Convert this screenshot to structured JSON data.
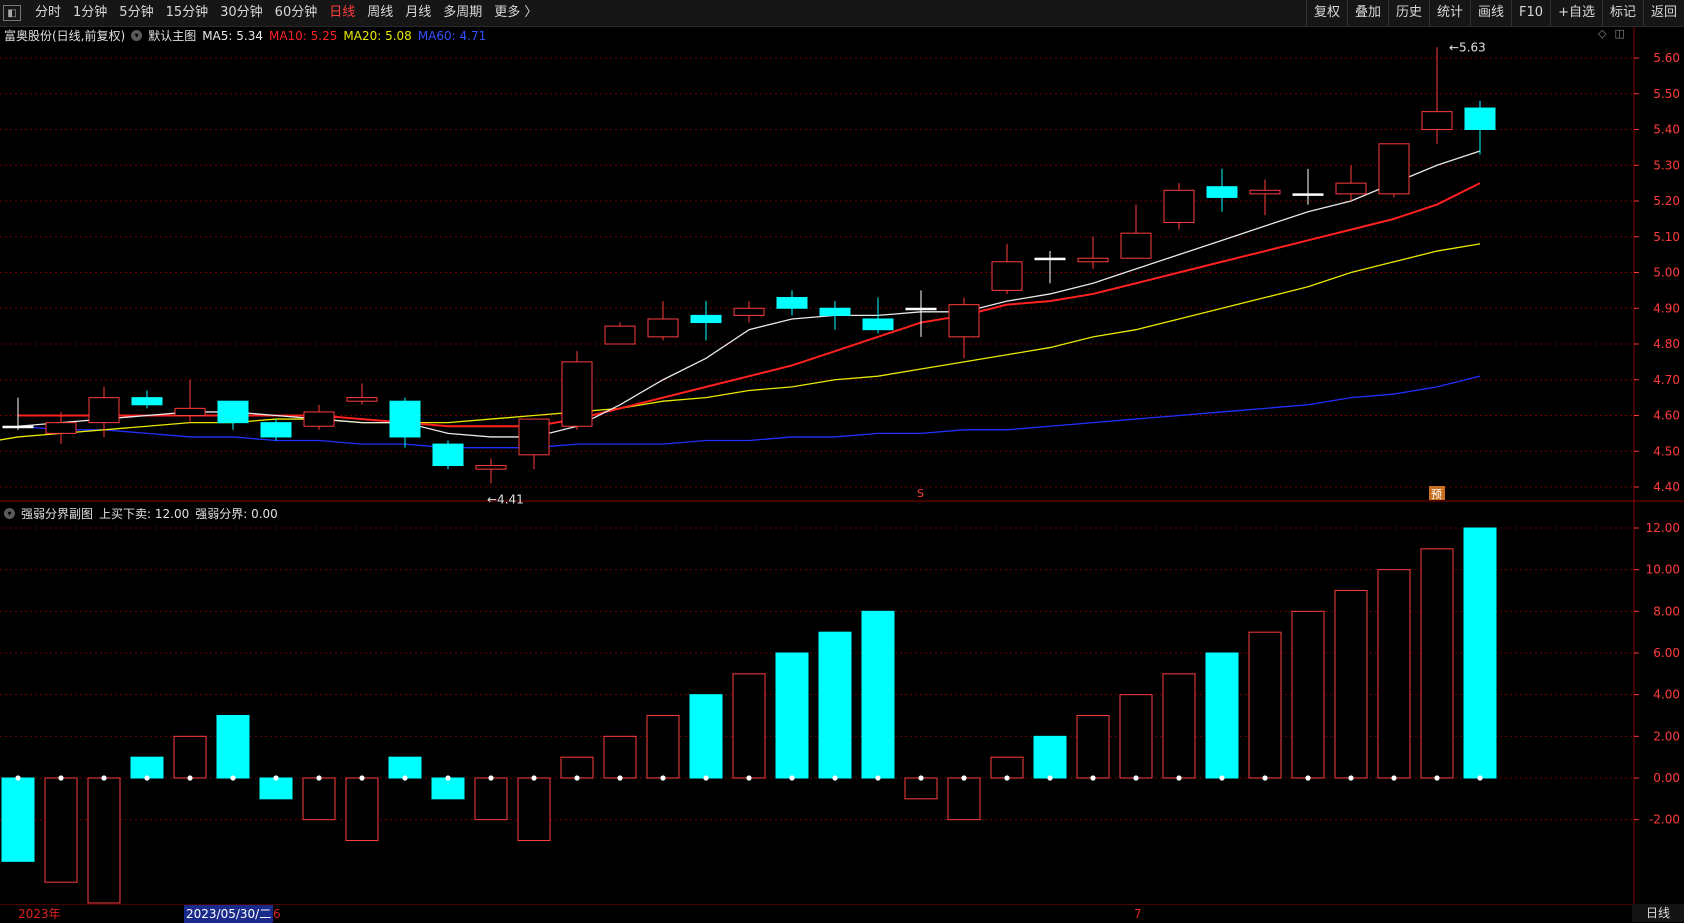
{
  "toolbar": {
    "periods": [
      "分时",
      "1分钟",
      "5分钟",
      "15分钟",
      "30分钟",
      "60分钟",
      "日线",
      "周线",
      "月线",
      "多周期",
      "更多 〉"
    ],
    "active_period": "日线",
    "right_buttons": [
      "复权",
      "叠加",
      "历史",
      "统计",
      "画线",
      "F10",
      "+自选",
      "标记",
      "返回"
    ]
  },
  "main_header": {
    "stock": "富奥股份(日线,前复权)",
    "template": "默认主图",
    "ma5": "MA5: 5.34",
    "ma10": "MA10: 5.25",
    "ma20": "MA20: 5.08",
    "ma60": "MA60: 4.71"
  },
  "sub_header": {
    "title": "强弱分界副图",
    "buy_sell": "上买下卖: 12.00",
    "boundary": "强弱分界: 0.00"
  },
  "top_icons": [
    "diamond-icon",
    "panel-icon"
  ],
  "annotations": {
    "high": "5.63",
    "low": "4.41",
    "marker_s": "S",
    "marker_yu": "预"
  },
  "bottom": {
    "year": "2023年",
    "cursor_date": "2023/05/30/二",
    "month6": "6",
    "month7": "7",
    "period": "日线"
  },
  "colors": {
    "up": "#ff3c3c",
    "down": "#00ffff",
    "flat": "#ffffff",
    "ma5": "#e8e8e8",
    "ma10": "#ff2020",
    "ma20": "#e8e800",
    "ma60": "#2030ff",
    "grid": "#6a0000",
    "axis_text": "#ff3c3c"
  },
  "chart_data": [
    {
      "type": "candlestick",
      "title": "富奥股份(日线,前复权)",
      "y_ticks": [
        "5.60",
        "5.50",
        "5.40",
        "5.30",
        "5.20",
        "5.10",
        "5.00",
        "4.90",
        "4.80",
        "4.70",
        "4.60",
        "4.50",
        "4.40"
      ],
      "ylim": [
        4.39,
        5.65
      ],
      "candles": [
        {
          "o": 4.57,
          "h": 4.65,
          "l": 4.56,
          "c": 4.57
        },
        {
          "o": 4.55,
          "h": 4.61,
          "l": 4.52,
          "c": 4.58
        },
        {
          "o": 4.58,
          "h": 4.68,
          "l": 4.54,
          "c": 4.65
        },
        {
          "o": 4.65,
          "h": 4.67,
          "l": 4.62,
          "c": 4.63
        },
        {
          "o": 4.6,
          "h": 4.7,
          "l": 4.58,
          "c": 4.62
        },
        {
          "o": 4.64,
          "h": 4.64,
          "l": 4.56,
          "c": 4.58
        },
        {
          "o": 4.58,
          "h": 4.59,
          "l": 4.53,
          "c": 4.54
        },
        {
          "o": 4.57,
          "h": 4.63,
          "l": 4.56,
          "c": 4.61
        },
        {
          "o": 4.64,
          "h": 4.69,
          "l": 4.63,
          "c": 4.65
        },
        {
          "o": 4.64,
          "h": 4.65,
          "l": 4.51,
          "c": 4.54
        },
        {
          "o": 4.52,
          "h": 4.53,
          "l": 4.45,
          "c": 4.46
        },
        {
          "o": 4.45,
          "h": 4.48,
          "l": 4.41,
          "c": 4.46
        },
        {
          "o": 4.49,
          "h": 4.59,
          "l": 4.45,
          "c": 4.59
        },
        {
          "o": 4.57,
          "h": 4.78,
          "l": 4.56,
          "c": 4.75
        },
        {
          "o": 4.8,
          "h": 4.86,
          "l": 4.8,
          "c": 4.85
        },
        {
          "o": 4.82,
          "h": 4.92,
          "l": 4.81,
          "c": 4.87
        },
        {
          "o": 4.88,
          "h": 4.92,
          "l": 4.81,
          "c": 4.86
        },
        {
          "o": 4.88,
          "h": 4.92,
          "l": 4.86,
          "c": 4.9
        },
        {
          "o": 4.93,
          "h": 4.95,
          "l": 4.88,
          "c": 4.9
        },
        {
          "o": 4.9,
          "h": 4.92,
          "l": 4.84,
          "c": 4.88
        },
        {
          "o": 4.87,
          "h": 4.93,
          "l": 4.83,
          "c": 4.84
        },
        {
          "o": 4.9,
          "h": 4.95,
          "l": 4.82,
          "c": 4.9
        },
        {
          "o": 4.82,
          "h": 4.93,
          "l": 4.76,
          "c": 4.91
        },
        {
          "o": 4.95,
          "h": 5.08,
          "l": 4.94,
          "c": 5.03
        },
        {
          "o": 5.04,
          "h": 5.06,
          "l": 4.97,
          "c": 5.04
        },
        {
          "o": 5.03,
          "h": 5.1,
          "l": 5.01,
          "c": 5.04
        },
        {
          "o": 5.04,
          "h": 5.19,
          "l": 5.04,
          "c": 5.11
        },
        {
          "o": 5.14,
          "h": 5.25,
          "l": 5.12,
          "c": 5.23
        },
        {
          "o": 5.24,
          "h": 5.29,
          "l": 5.17,
          "c": 5.21
        },
        {
          "o": 5.22,
          "h": 5.26,
          "l": 5.16,
          "c": 5.23
        },
        {
          "o": 5.22,
          "h": 5.29,
          "l": 5.19,
          "c": 5.22
        },
        {
          "o": 5.22,
          "h": 5.3,
          "l": 5.2,
          "c": 5.25
        },
        {
          "o": 5.22,
          "h": 5.36,
          "l": 5.21,
          "c": 5.36
        },
        {
          "o": 5.4,
          "h": 5.63,
          "l": 5.36,
          "c": 5.45
        },
        {
          "o": 5.46,
          "h": 5.48,
          "l": 5.33,
          "c": 5.4
        }
      ],
      "ma5": [
        4.57,
        4.58,
        4.59,
        4.6,
        4.61,
        4.61,
        4.6,
        4.59,
        4.58,
        4.58,
        4.55,
        4.54,
        4.54,
        4.57,
        4.63,
        4.7,
        4.76,
        4.84,
        4.87,
        4.88,
        4.88,
        4.89,
        4.89,
        4.92,
        4.94,
        4.97,
        5.01,
        5.05,
        5.09,
        5.13,
        5.17,
        5.2,
        5.25,
        5.3,
        5.34
      ],
      "ma10": [
        4.6,
        4.6,
        4.6,
        4.6,
        4.6,
        4.6,
        4.6,
        4.6,
        4.59,
        4.58,
        4.57,
        4.57,
        4.57,
        4.59,
        4.62,
        4.65,
        4.68,
        4.71,
        4.74,
        4.78,
        4.82,
        4.86,
        4.88,
        4.91,
        4.92,
        4.94,
        4.97,
        5.0,
        5.03,
        5.06,
        5.09,
        5.12,
        5.15,
        5.19,
        5.25
      ],
      "ma20": [
        4.51,
        4.52,
        4.54,
        4.55,
        4.56,
        4.57,
        4.58,
        4.58,
        4.59,
        4.59,
        4.58,
        4.58,
        4.58,
        4.59,
        4.6,
        4.61,
        4.62,
        4.64,
        4.65,
        4.67,
        4.68,
        4.7,
        4.71,
        4.73,
        4.75,
        4.77,
        4.79,
        4.82,
        4.84,
        4.87,
        4.9,
        4.93,
        4.96,
        5.0,
        5.03,
        5.06,
        5.08
      ],
      "ma60": [
        4.57,
        4.56,
        4.56,
        4.55,
        4.54,
        4.54,
        4.53,
        4.53,
        4.52,
        4.52,
        4.51,
        4.51,
        4.51,
        4.52,
        4.52,
        4.52,
        4.53,
        4.53,
        4.54,
        4.54,
        4.55,
        4.55,
        4.56,
        4.56,
        4.57,
        4.58,
        4.59,
        4.6,
        4.61,
        4.62,
        4.63,
        4.65,
        4.66,
        4.68,
        4.71
      ]
    },
    {
      "type": "bar",
      "title": "强弱分界副图",
      "y_ticks": [
        "12.00",
        "10.00",
        "8.00",
        "6.00",
        "4.00",
        "2.00",
        "0.00",
        "-2.00"
      ],
      "ylim": [
        -6.4,
        12.5
      ],
      "values": [
        -4,
        -5,
        -6,
        1,
        2,
        3,
        -1,
        -2,
        -3,
        1,
        -1,
        -2,
        -3,
        1,
        2,
        3,
        4,
        5,
        6,
        7,
        8,
        -1,
        -2,
        1,
        2,
        3,
        4,
        5,
        6,
        7,
        8,
        9,
        10,
        11,
        12
      ],
      "filled": [
        true,
        false,
        false,
        true,
        false,
        true,
        true,
        false,
        false,
        true,
        true,
        false,
        false,
        false,
        false,
        false,
        true,
        false,
        true,
        true,
        true,
        false,
        false,
        false,
        true,
        false,
        false,
        false,
        true,
        false,
        false,
        false,
        false,
        false,
        true
      ]
    }
  ]
}
